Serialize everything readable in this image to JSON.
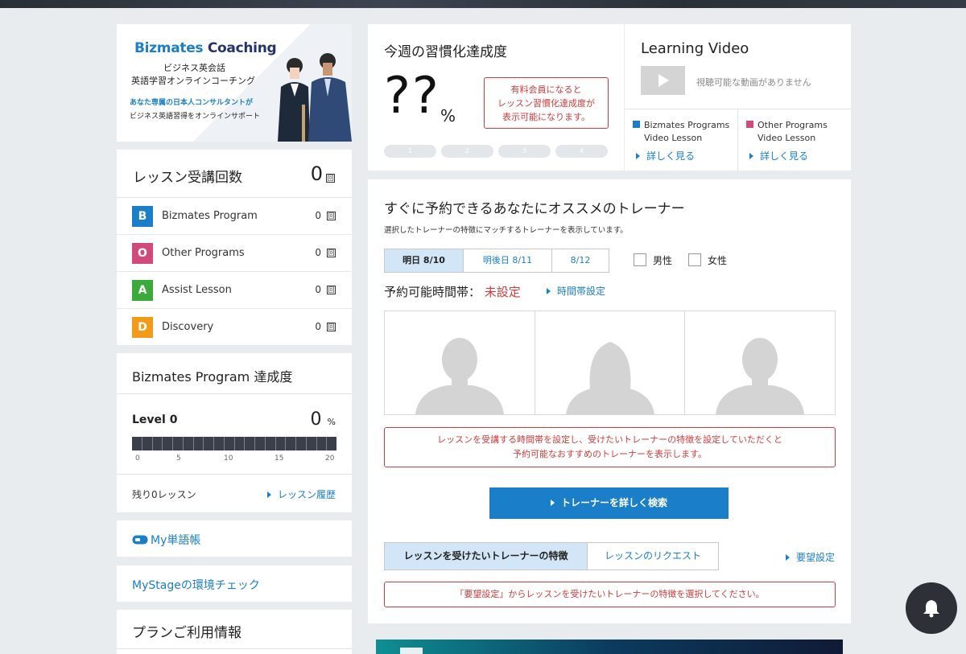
{
  "banner": {
    "brand_a": "Bizmates",
    "brand_b": " Coaching",
    "line1": "ビジネス英会話",
    "line2": "英語学習オンラインコーチング",
    "line3": "あなた専属の日本人コンサルタントが",
    "line4": "ビジネス英語習得をオンラインサポート"
  },
  "lessons": {
    "title": "レッスン受講回数",
    "total": "0",
    "unit": "回",
    "rows": [
      {
        "letter": "B",
        "label": "Bizmates Program",
        "count": "0",
        "color": "#1a7fc8"
      },
      {
        "letter": "O",
        "label": "Other Programs",
        "count": "0",
        "color": "#d14b7a"
      },
      {
        "letter": "A",
        "label": "Assist Lesson",
        "count": "0",
        "color": "#3aaa3a"
      },
      {
        "letter": "D",
        "label": "Discovery",
        "count": "0",
        "color": "#f29b1b"
      }
    ]
  },
  "progress": {
    "title": "Bizmates Program 達成度",
    "level": "Level 0",
    "percent": "0",
    "percent_unit": "%",
    "fill": 0,
    "ticks": [
      "0",
      "5",
      "10",
      "15",
      "20"
    ],
    "remaining": "残り0レッスン",
    "history_link": "レッスン履歴"
  },
  "left_links": {
    "vocab": "My単語帳",
    "env_check": "MyStageの環境チェック"
  },
  "plan": {
    "title": "プランご利用情報"
  },
  "habit": {
    "title": "今週の習慣化達成度",
    "value": "??",
    "unit": "%",
    "note_l1": "有料会員になると",
    "note_l2": "レッスン習慣化達成度が",
    "note_l3": "表示可能になります。",
    "weeks": [
      "1",
      "2",
      "3",
      "4"
    ]
  },
  "video": {
    "title": "Learning Video",
    "empty": "視聴可能な動画がありません",
    "col1_l1": "Bizmates Programs",
    "col1_l2": "Video Lesson",
    "col2_l1": "Other Programs",
    "col2_l2": "Video Lesson",
    "more": "詳しく見る",
    "col1_color": "#1a7fc8",
    "col2_color": "#d14b7a"
  },
  "recommend": {
    "title": "すぐに予約できるあなたにオススメのトレーナー",
    "subtitle": "選択したトレーナーの特徴にマッチするトレーナーを表示しています。",
    "date_tabs": [
      "明日 8/10",
      "明後日 8/11",
      "8/12"
    ],
    "male": "男性",
    "female": "女性",
    "avail_label": "予約可能時間帯：",
    "avail_value": "未設定",
    "time_setting": "時間帯設定",
    "warn_l1": "レッスンを受講する時間帯を設定し、受けたいトレーナーの特徴を設定していただくと",
    "warn_l2": "予約可能なおすすめのトレーナーを表示します。",
    "search_button": "トレーナーを詳しく検索",
    "bottom_tabs": [
      "レッスンを受けたいトレーナーの特徴",
      "レッスンのリクエスト"
    ],
    "request_setting": "要望設定",
    "warn2": "「要望設定」からレッスンを受けたいトレーナーの特徴を選択してください。"
  }
}
